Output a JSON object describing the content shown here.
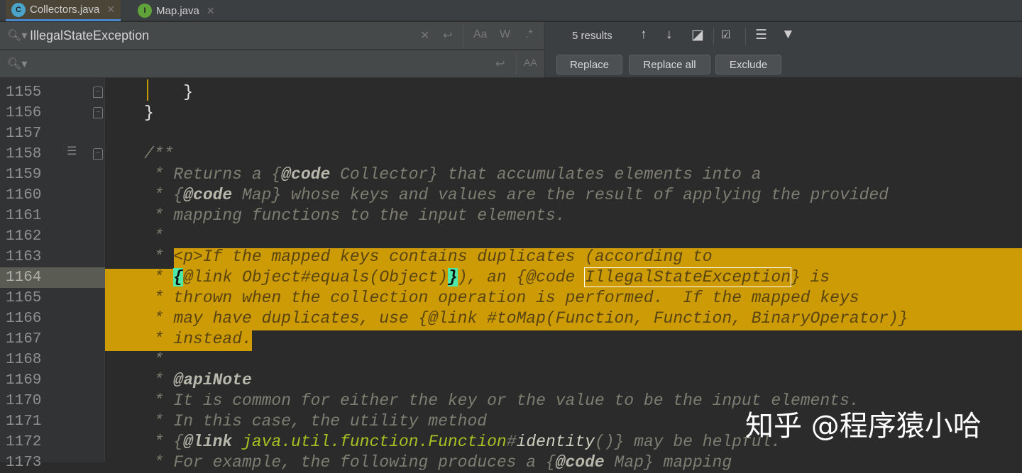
{
  "tabs": [
    {
      "label": "Collectors.java",
      "icon": "C",
      "active": true
    },
    {
      "label": "Map.java",
      "icon": "I",
      "active": false
    }
  ],
  "find": {
    "search_value": "IllegalStateException",
    "replace_value": "",
    "results": "5 results",
    "match_case": "Aa",
    "words": "W",
    "regex": ".*",
    "preserve_case": "AA"
  },
  "buttons": {
    "replace": "Replace",
    "replace_all": "Replace all",
    "exclude": "Exclude"
  },
  "colors": {
    "selection": "#cc9b05",
    "accent": "#4a88c7"
  },
  "line_numbers": [
    "1155",
    "1156",
    "1157",
    "1158",
    "1159",
    "1160",
    "1161",
    "1162",
    "1163",
    "1164",
    "1165",
    "1166",
    "1167",
    "1168",
    "1169",
    "1170",
    "1171",
    "1172",
    "1173"
  ],
  "current_line": "1164",
  "code": [
    [
      [
        "    }",
        "w"
      ]
    ],
    [
      [
        "}",
        "w"
      ]
    ],
    [],
    [
      [
        "/**",
        "c"
      ]
    ],
    [
      [
        " * Returns a {",
        "c"
      ],
      [
        "@code",
        "tag"
      ],
      [
        " Collector} that accumulates elements into a",
        "c"
      ]
    ],
    [
      [
        " * {",
        "c"
      ],
      [
        "@code",
        "tag"
      ],
      [
        " Map} whose keys and values are the result of applying the provided",
        "c"
      ]
    ],
    [
      [
        " * mapping functions to the input elements.",
        "c"
      ]
    ],
    [
      [
        " *",
        "c"
      ]
    ],
    [
      [
        " * ",
        "c"
      ],
      [
        "<p>If the mapped keys contains duplicates (according to",
        "h"
      ]
    ],
    [
      [
        " * ",
        "h"
      ],
      [
        "{",
        "br"
      ],
      [
        "@link Object#equals(Object)",
        "h"
      ],
      [
        "}",
        "br"
      ],
      [
        "), an {@code ",
        "h"
      ],
      [
        "IllegalStateException",
        "m"
      ],
      [
        "} is",
        "h"
      ]
    ],
    [
      [
        " * thrown when the collection operation is performed.  If the mapped keys",
        "h"
      ]
    ],
    [
      [
        " * may have duplicates, use {@link #toMap(Function, Function, BinaryOperator)}",
        "h"
      ]
    ],
    [
      [
        " * instead.",
        "h"
      ]
    ],
    [
      [
        " *",
        "c"
      ]
    ],
    [
      [
        " * ",
        "c"
      ],
      [
        "@apiNote",
        "tag"
      ]
    ],
    [
      [
        " * It is common for either the key or the value to be the input elements.",
        "c"
      ]
    ],
    [
      [
        " * In this case, the utility method",
        "c"
      ]
    ],
    [
      [
        " * {",
        "c"
      ],
      [
        "@link",
        "tag"
      ],
      [
        " ",
        "c"
      ],
      [
        "java.util.function.Function",
        "g"
      ],
      [
        "#",
        "c"
      ],
      [
        "identity",
        "id"
      ],
      [
        "()} may be helpful.",
        "c"
      ]
    ],
    [
      [
        " * For example, the following produces a {",
        "c"
      ],
      [
        "@code",
        "tag"
      ],
      [
        " Map} mapping",
        "c"
      ]
    ]
  ],
  "watermark": "知乎 @程序猿小哈"
}
